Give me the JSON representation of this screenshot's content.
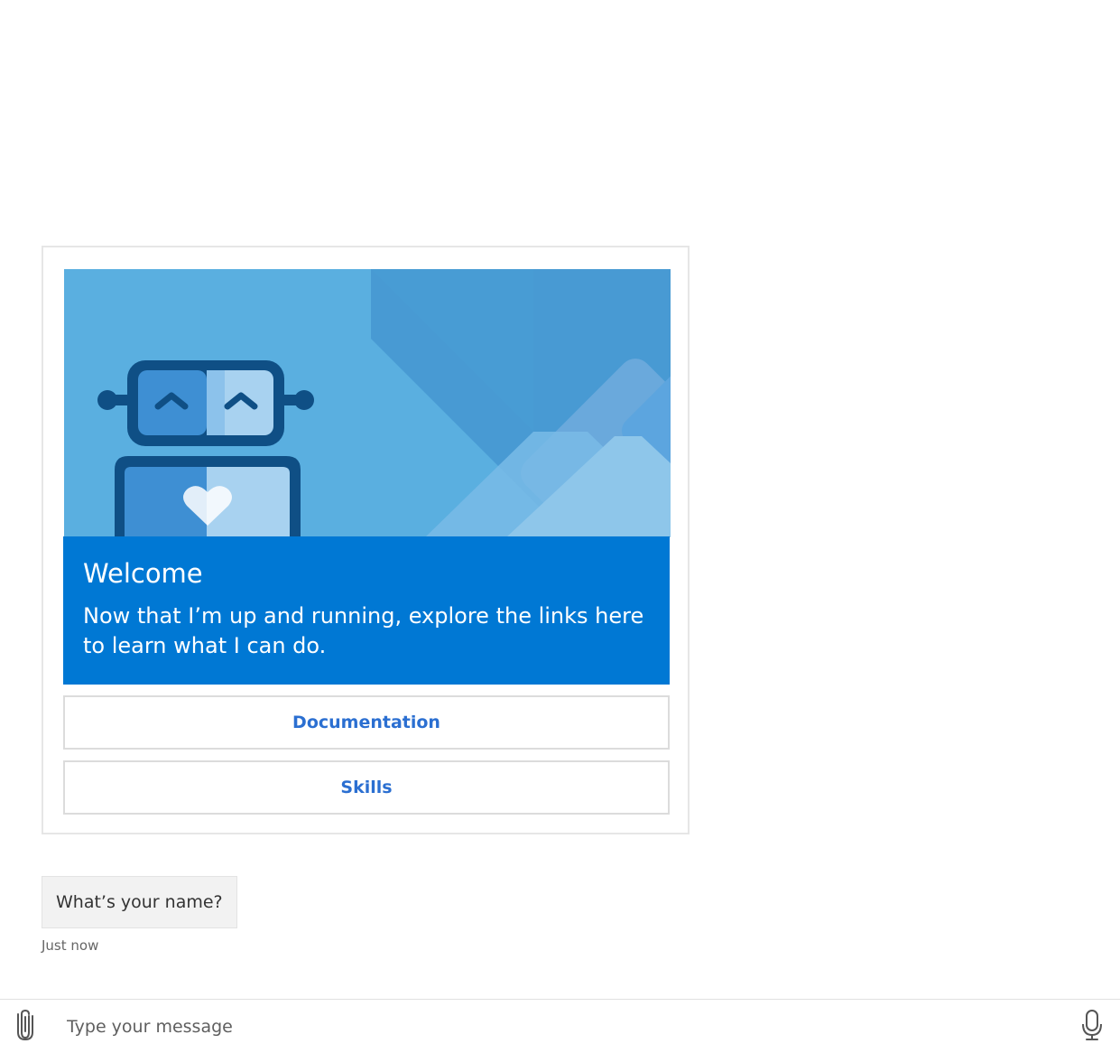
{
  "card": {
    "hero_image": "bot-welcome-illustration",
    "title": "Welcome",
    "text": "Now that I’m up and running, explore the links here to learn what I can do.",
    "actions": [
      {
        "label": "Documentation"
      },
      {
        "label": "Skills"
      }
    ]
  },
  "message": {
    "text": "What’s your name?",
    "timestamp": "Just now"
  },
  "composer": {
    "placeholder": "Type your message",
    "attach_icon": "paperclip-icon",
    "mic_icon": "microphone-icon"
  },
  "colors": {
    "accent": "#0078d4",
    "hero_background": "#5aafe0",
    "action_text": "#2b6fd1",
    "bubble_background": "#f2f2f2"
  }
}
